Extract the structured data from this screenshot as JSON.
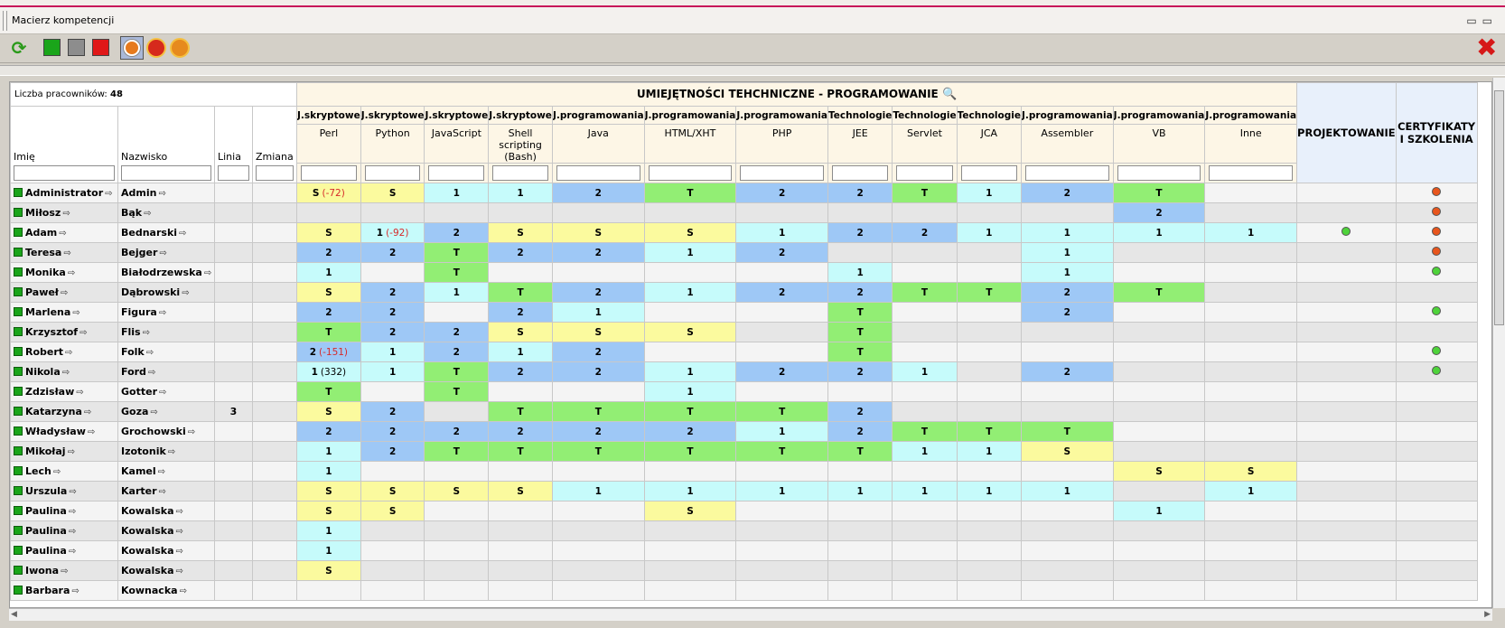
{
  "window": {
    "title": "Macierz kompetencji"
  },
  "employees_count_label": "Liczba pracowników:",
  "employees_count": "48",
  "columns": {
    "first_name": "Imię",
    "last_name": "Nazwisko",
    "line": "Linia",
    "shift": "Zmiana"
  },
  "group_title": "UMIEJĘTNOŚCI TEHCHNICZNE - PROGRAMOWANIE",
  "design_title": "PROJEKTOWANIE",
  "cert_title": "CERTYFIKATY I SZKOLENIA",
  "skills": [
    {
      "category": "J.skryptowe",
      "name": "Perl"
    },
    {
      "category": "J.skryptowe",
      "name": "Python"
    },
    {
      "category": "J.skryptowe",
      "name": "JavaScript"
    },
    {
      "category": "J.skryptowe",
      "name": "Shell scripting (Bash)"
    },
    {
      "category": "J.programowania",
      "name": "Java"
    },
    {
      "category": "J.programowania",
      "name": "HTML/XHT"
    },
    {
      "category": "J.programowania",
      "name": "PHP"
    },
    {
      "category": "Technologie",
      "name": "JEE"
    },
    {
      "category": "Technologie",
      "name": "Servlet"
    },
    {
      "category": "Technologie",
      "name": "JCA"
    },
    {
      "category": "J.programowania",
      "name": "Assembler"
    },
    {
      "category": "J.programowania",
      "name": "VB"
    },
    {
      "category": "J.programowania",
      "name": "Inne"
    }
  ],
  "colors": {
    "level_1": "#c6fbfb",
    "level_2": "#9ec8f6",
    "level_T": "#92ee74",
    "level_S": "#fbfa9e",
    "status_green": "#4ed33a",
    "status_orange": "#e8551c"
  },
  "rows": [
    {
      "first": "Administrator",
      "last": "Admin",
      "line": "",
      "shift": "",
      "vals": [
        [
          "S",
          "(-72)"
        ],
        "S",
        "1",
        "1",
        "2",
        "T",
        "2",
        "2",
        "T",
        "1",
        "2",
        "T",
        ""
      ],
      "design": "",
      "cert": "orange"
    },
    {
      "first": "Miłosz",
      "last": "Bąk",
      "line": "",
      "shift": "",
      "vals": [
        "",
        "",
        "",
        "",
        "",
        "",
        "",
        "",
        "",
        "",
        "",
        "2",
        ""
      ],
      "design": "",
      "cert": "orange"
    },
    {
      "first": "Adam",
      "last": "Bednarski",
      "line": "",
      "shift": "",
      "vals": [
        "S",
        [
          "1",
          "(-92)"
        ],
        "2",
        "S",
        "S",
        "S",
        "1",
        "2",
        "2",
        "1",
        "1",
        "1",
        "1"
      ],
      "design": "green",
      "cert": "orange"
    },
    {
      "first": "Teresa",
      "last": "Bejger",
      "line": "",
      "shift": "",
      "vals": [
        "2",
        "2",
        "T",
        "2",
        "2",
        "1",
        "2",
        "",
        "",
        "",
        "1",
        "",
        ""
      ],
      "design": "",
      "cert": "orange"
    },
    {
      "first": "Monika",
      "last": "Białodrzewska",
      "line": "",
      "shift": "",
      "vals": [
        "1",
        "",
        "T",
        "",
        "",
        "",
        "",
        "1",
        "",
        "",
        "1",
        "",
        ""
      ],
      "design": "",
      "cert": "green"
    },
    {
      "first": "Paweł",
      "last": "Dąbrowski",
      "line": "",
      "shift": "",
      "vals": [
        "S",
        "2",
        "1",
        "T",
        "2",
        "1",
        "2",
        "2",
        "T",
        "T",
        "2",
        "T",
        ""
      ],
      "design": "",
      "cert": ""
    },
    {
      "first": "Marlena",
      "last": "Figura",
      "line": "",
      "shift": "",
      "vals": [
        "2",
        "2",
        "",
        "2",
        "1",
        "",
        "",
        "T",
        "",
        "",
        "2",
        "",
        ""
      ],
      "design": "",
      "cert": "green"
    },
    {
      "first": "Krzysztof",
      "last": "Flis",
      "line": "",
      "shift": "",
      "vals": [
        "T",
        "2",
        "2",
        "S",
        "S",
        "S",
        "",
        "T",
        "",
        "",
        "",
        "",
        ""
      ],
      "design": "",
      "cert": ""
    },
    {
      "first": "Robert",
      "last": "Folk",
      "line": "",
      "shift": "",
      "vals": [
        [
          "2",
          "(-151)"
        ],
        "1",
        "2",
        "1",
        "2",
        "",
        "",
        "T",
        "",
        "",
        "",
        "",
        ""
      ],
      "design": "",
      "cert": "green"
    },
    {
      "first": "Nikola",
      "last": "Ford",
      "line": "",
      "shift": "",
      "vals": [
        [
          "1",
          "(332)"
        ],
        "1",
        "T",
        "2",
        "2",
        "1",
        "2",
        "2",
        "1",
        "",
        "2",
        "",
        ""
      ],
      "design": "",
      "cert": "green"
    },
    {
      "first": "Zdzisław",
      "last": "Gotter",
      "line": "",
      "shift": "",
      "vals": [
        "T",
        "",
        "T",
        "",
        "",
        "1",
        "",
        "",
        "",
        "",
        "",
        "",
        ""
      ],
      "design": "",
      "cert": ""
    },
    {
      "first": "Katarzyna",
      "last": "Goza",
      "line": "3",
      "shift": "",
      "vals": [
        "S",
        "2",
        "",
        "T",
        "T",
        "T",
        "T",
        "2",
        "",
        "",
        "",
        "",
        ""
      ],
      "design": "",
      "cert": ""
    },
    {
      "first": "Władysław",
      "last": "Grochowski",
      "line": "",
      "shift": "",
      "vals": [
        "2",
        "2",
        "2",
        "2",
        "2",
        "2",
        "1",
        "2",
        "T",
        "T",
        "T",
        "",
        ""
      ],
      "design": "",
      "cert": ""
    },
    {
      "first": "Mikołaj",
      "last": "Izotonik",
      "line": "",
      "shift": "",
      "vals": [
        "1",
        "2",
        "T",
        "T",
        "T",
        "T",
        "T",
        "T",
        "1",
        "1",
        "S",
        "",
        ""
      ],
      "design": "",
      "cert": ""
    },
    {
      "first": "Lech",
      "last": "Kamel",
      "line": "",
      "shift": "",
      "vals": [
        "1",
        "",
        "",
        "",
        "",
        "",
        "",
        "",
        "",
        "",
        "",
        "S",
        "S"
      ],
      "design": "",
      "cert": ""
    },
    {
      "first": "Urszula",
      "last": "Karter",
      "line": "",
      "shift": "",
      "vals": [
        "S",
        "S",
        "S",
        "S",
        "1",
        "1",
        "1",
        "1",
        "1",
        "1",
        "1",
        "",
        "1"
      ],
      "design": "",
      "cert": ""
    },
    {
      "first": "Paulina",
      "last": "Kowalska",
      "line": "",
      "shift": "",
      "vals": [
        "S",
        "S",
        "",
        "",
        "",
        "S",
        "",
        "",
        "",
        "",
        "",
        "1",
        ""
      ],
      "design": "",
      "cert": ""
    },
    {
      "first": "Paulina",
      "last": "Kowalska",
      "line": "",
      "shift": "",
      "vals": [
        "1",
        "",
        "",
        "",
        "",
        "",
        "",
        "",
        "",
        "",
        "",
        "",
        ""
      ],
      "design": "",
      "cert": ""
    },
    {
      "first": "Paulina",
      "last": "Kowalska",
      "line": "",
      "shift": "",
      "vals": [
        "1",
        "",
        "",
        "",
        "",
        "",
        "",
        "",
        "",
        "",
        "",
        "",
        ""
      ],
      "design": "",
      "cert": ""
    },
    {
      "first": "Iwona",
      "last": "Kowalska",
      "line": "",
      "shift": "",
      "vals": [
        "S",
        "",
        "",
        "",
        "",
        "",
        "",
        "",
        "",
        "",
        "",
        "",
        ""
      ],
      "design": "",
      "cert": ""
    },
    {
      "first": "Barbara",
      "last": "Kownacka",
      "line": "",
      "shift": "",
      "vals": [
        "",
        "",
        "",
        "",
        "",
        "",
        "",
        "",
        "",
        "",
        "",
        "",
        ""
      ],
      "design": "",
      "cert": ""
    }
  ]
}
